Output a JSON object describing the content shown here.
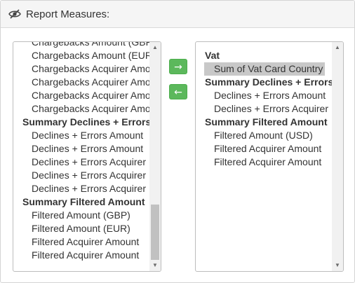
{
  "header": {
    "title": "Report Measures:",
    "icon": "eye-slash-icon"
  },
  "buttons": {
    "move_right_label": "→",
    "move_left_label": "←",
    "color": "#5cb85c"
  },
  "available_list": {
    "rows": [
      {
        "type": "option",
        "label": "Chargebacks Amount (GBP)"
      },
      {
        "type": "option",
        "label": "Chargebacks Amount (EUR)"
      },
      {
        "type": "option",
        "label": "Chargebacks Acquirer Amount"
      },
      {
        "type": "option",
        "label": "Chargebacks Acquirer Amount"
      },
      {
        "type": "option",
        "label": "Chargebacks Acquirer Amount"
      },
      {
        "type": "option",
        "label": "Chargebacks Acquirer Amount"
      },
      {
        "type": "group",
        "label": "Summary Declines + Errors"
      },
      {
        "type": "option",
        "label": "Declines + Errors Amount"
      },
      {
        "type": "option",
        "label": "Declines + Errors Amount"
      },
      {
        "type": "option",
        "label": "Declines + Errors Acquirer"
      },
      {
        "type": "option",
        "label": "Declines + Errors Acquirer"
      },
      {
        "type": "option",
        "label": "Declines + Errors Acquirer"
      },
      {
        "type": "group",
        "label": "Summary Filtered Amount"
      },
      {
        "type": "option",
        "label": "Filtered Amount (GBP)"
      },
      {
        "type": "option",
        "label": "Filtered Amount (EUR)"
      },
      {
        "type": "option",
        "label": "Filtered Acquirer Amount"
      },
      {
        "type": "option",
        "label": "Filtered Acquirer Amount"
      }
    ]
  },
  "selected_list": {
    "rows": [
      {
        "type": "group",
        "label": "Vat"
      },
      {
        "type": "option",
        "label": "Sum of Vat Card Country",
        "selected": true
      },
      {
        "type": "group",
        "label": "Summary Declines + Errors"
      },
      {
        "type": "option",
        "label": "Declines + Errors Amount"
      },
      {
        "type": "option",
        "label": "Declines + Errors Acquirer"
      },
      {
        "type": "group",
        "label": "Summary Filtered Amount"
      },
      {
        "type": "option",
        "label": "Filtered Amount (USD)"
      },
      {
        "type": "option",
        "label": "Filtered Acquirer Amount"
      },
      {
        "type": "option",
        "label": "Filtered Acquirer Amount"
      }
    ]
  },
  "scroll_arrows": {
    "up": "▲",
    "down": "▼"
  }
}
